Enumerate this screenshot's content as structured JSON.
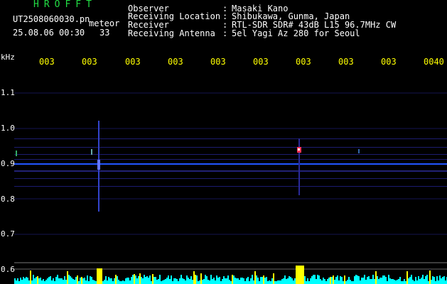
{
  "header": {
    "title": "HROFFT",
    "file_name": "UT2508060030.pn",
    "mode": "meteor",
    "date_time": "25.08.06 00:30",
    "count": "33",
    "info_labels": [
      "Observer",
      "Receiving Location",
      "Receiver",
      "Receiving Antenna"
    ],
    "info_colons": [
      ":",
      ":",
      ":",
      ":"
    ],
    "info_values": [
      "Masaki Kano",
      "Shibukawa, Gunma, Japan",
      "RTL-SDR SDR# 43dB L15 96.7MHz CW",
      "5el Yagi Az 280 for Seoul"
    ]
  },
  "axis": {
    "y_unit": "kHz",
    "y_labels": [
      "1.1",
      "1.0",
      "0.9",
      "0.8",
      "0.7",
      "0.6"
    ],
    "x_labels": [
      "003",
      "003",
      "003",
      "003",
      "003",
      "003",
      "003",
      "003",
      "003",
      "0040"
    ]
  },
  "colors": {
    "text": "#ffffff",
    "ticks": "#ffff00",
    "title": "#22dd44",
    "signal_line": "#2255ff",
    "bottom_spectrum": "#00ffff",
    "meteor_peak": "#ffff00",
    "grid": "#1a1a66"
  }
}
